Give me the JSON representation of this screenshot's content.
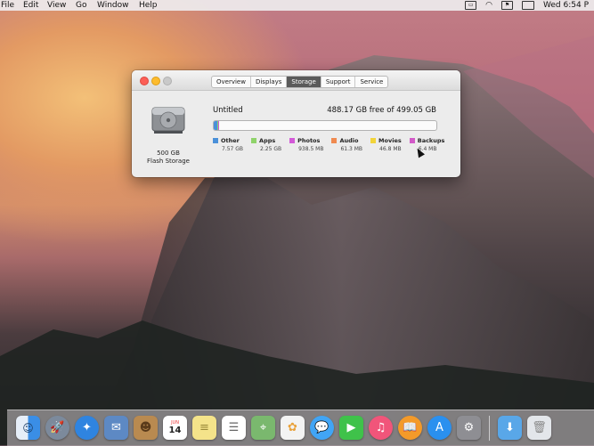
{
  "menubar": {
    "items": [
      "File",
      "Edit",
      "View",
      "Go",
      "Window",
      "Help"
    ],
    "clock": "Wed 6:54 P"
  },
  "window": {
    "tabs": [
      {
        "label": "Overview",
        "active": false
      },
      {
        "label": "Displays",
        "active": false
      },
      {
        "label": "Storage",
        "active": true
      },
      {
        "label": "Support",
        "active": false
      },
      {
        "label": "Service",
        "active": false
      }
    ],
    "disk": {
      "icon": "hard-drive-icon",
      "size": "500 GB",
      "type": "Flash Storage"
    },
    "volume": {
      "name": "Untitled",
      "free": "488.17 GB free of 499.05 GB"
    },
    "legend": [
      {
        "label": "Other",
        "size": "7.57 GB",
        "color": "#4a90d9"
      },
      {
        "label": "Apps",
        "size": "2.25 GB",
        "color": "#8fd36a"
      },
      {
        "label": "Photos",
        "size": "938.5 MB",
        "color": "#d35ad8"
      },
      {
        "label": "Audio",
        "size": "61.3 MB",
        "color": "#f08a50"
      },
      {
        "label": "Movies",
        "size": "46.8 MB",
        "color": "#f2d43a"
      },
      {
        "label": "Backups",
        "size": "6.4 MB",
        "color": "#d25ac8"
      }
    ]
  },
  "dock": {
    "calendar": {
      "month": "JUN",
      "day": "14"
    },
    "apps": [
      {
        "name": "finder",
        "icon": "finder-icon",
        "color": "#3a8ee6"
      },
      {
        "name": "launchpad",
        "icon": "rocket-icon",
        "color": "#7c8a9c"
      },
      {
        "name": "safari",
        "icon": "compass-icon",
        "color": "#2f84e0"
      },
      {
        "name": "mail",
        "icon": "stamp-icon",
        "color": "#5d89c4"
      },
      {
        "name": "contacts",
        "icon": "contacts-book-icon",
        "color": "#b98a50"
      },
      {
        "name": "calendar",
        "icon": "calendar-icon",
        "color": "#ffffff"
      },
      {
        "name": "notes",
        "icon": "notepad-icon",
        "color": "#f4e38a"
      },
      {
        "name": "reminders",
        "icon": "checklist-icon",
        "color": "#ffffff"
      },
      {
        "name": "maps",
        "icon": "map-icon",
        "color": "#7ab86e"
      },
      {
        "name": "photos",
        "icon": "flower-icon",
        "color": "#f3f3f3"
      },
      {
        "name": "messages",
        "icon": "speech-bubble-icon",
        "color": "#41a5f5"
      },
      {
        "name": "facetime",
        "icon": "video-camera-icon",
        "color": "#3fc24a"
      },
      {
        "name": "itunes",
        "icon": "music-note-icon",
        "color": "#f1557a"
      },
      {
        "name": "ibooks",
        "icon": "book-icon",
        "color": "#f39a2a"
      },
      {
        "name": "app-store",
        "icon": "app-store-icon",
        "color": "#2a90ef"
      },
      {
        "name": "system-preferences",
        "icon": "gear-icon",
        "color": "#8e8e93"
      },
      {
        "name": "downloads",
        "icon": "folder-icon",
        "color": "#59a7e8"
      },
      {
        "name": "trash",
        "icon": "trash-icon",
        "color": "#e3e6ea"
      }
    ]
  }
}
